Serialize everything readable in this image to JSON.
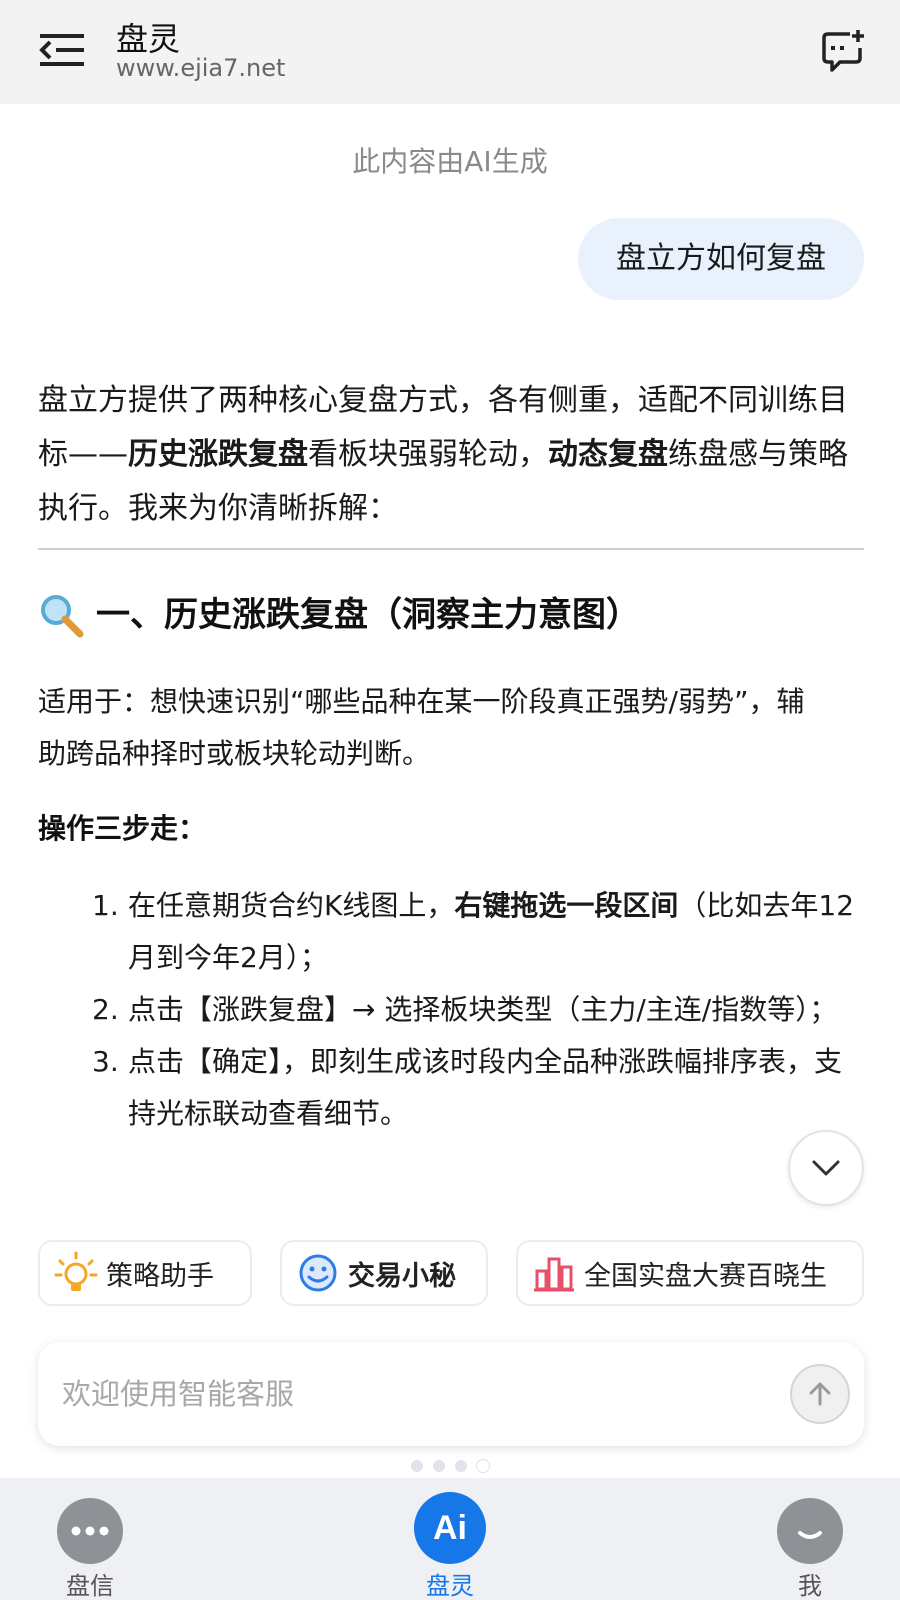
{
  "header": {
    "title": "盘灵",
    "url": "www.ejia7.net"
  },
  "chat": {
    "ai_notice": "此内容由AI生成",
    "user_message": "盘立方如何复盘",
    "answer": {
      "intro_part1": "盘立方提供了两种核心复盘方式，各有侧重，适配不同训练目标——",
      "intro_bold1": "历史涨跌复盘",
      "intro_part2": "看板块强弱轮动，",
      "intro_bold2": "动态复盘",
      "intro_part3": "练盘感与策略执行。我来为你清晰拆解：",
      "section_title": "一、历史涨跌复盘（洞察主力意图）",
      "applies": "适用于：想快速识别“哪些品种在某一阶段真正强势/弱势”，辅助跨品种择时或板块轮动判断。",
      "steps_title": "操作三步走：",
      "steps": [
        {
          "num": "1.",
          "pre": "在任意期货合约K线图上，",
          "bold": "右键拖选一段区间",
          "post": "（比如去年12月到今年2月）；"
        },
        {
          "num": "2.",
          "pre": "点击【涨跌复盘】→ 选择板块类型（主力/主连/指数等）；",
          "bold": "",
          "post": ""
        },
        {
          "num": "3.",
          "pre": "点击【确定】，即刻生成该时段内全品种涨跌幅排序表，支持光标联动查看细节。",
          "bold": "",
          "post": ""
        }
      ]
    }
  },
  "quick_chips": [
    {
      "label": "策略助手",
      "icon": "lightbulb-icon",
      "color": "#f5a623"
    },
    {
      "label": "交易小秘",
      "icon": "smile-bot-icon",
      "color": "#2f7be8"
    },
    {
      "label": "全国实盘大赛百晓生",
      "icon": "bar-chart-icon",
      "color": "#e8506a"
    }
  ],
  "input": {
    "placeholder": "欢迎使用智能客服"
  },
  "bottom_nav": [
    {
      "label": "盘信",
      "icon": "more-dots-icon"
    },
    {
      "label": "盘灵",
      "icon": "ai-icon",
      "icon_text": "Ai",
      "active": true
    },
    {
      "label": "我",
      "icon": "profile-icon"
    }
  ],
  "colors": {
    "accent": "#1677e8",
    "user_bubble": "#e9f2fc",
    "header_bg": "#f3f3f3"
  }
}
